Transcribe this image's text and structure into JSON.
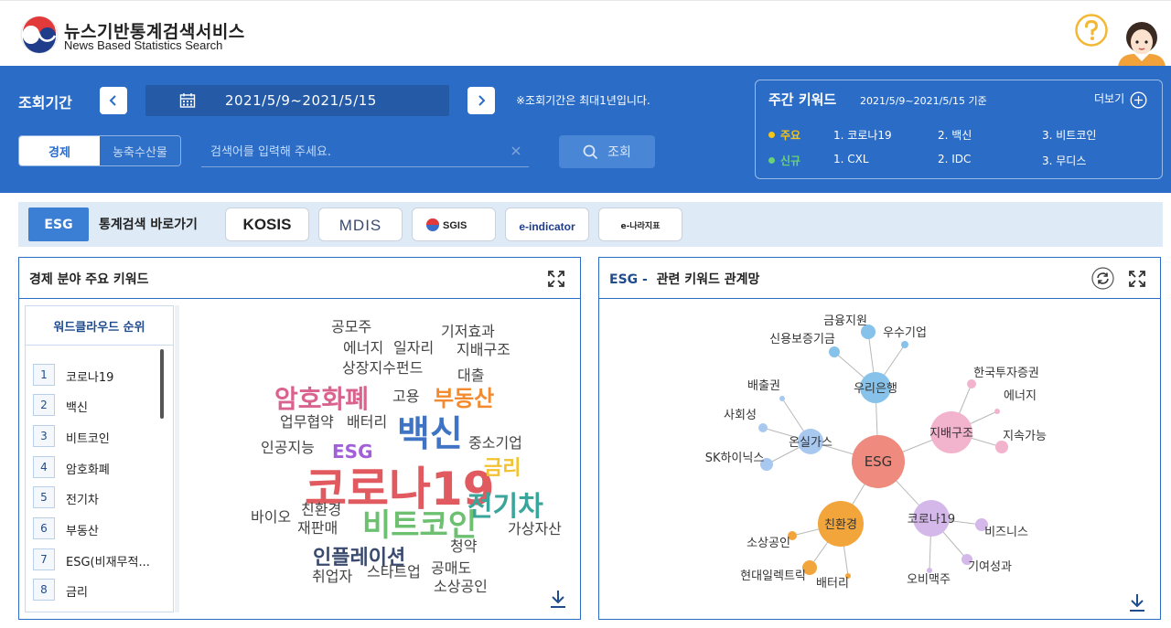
{
  "header": {
    "title": "뉴스기반통계검색서비스",
    "subtitle": "News Based Statistics Search"
  },
  "search": {
    "period_label": "조회기간",
    "date_range": "2021/5/9~2021/5/15",
    "period_note": "※조회기간은 최대1년입니다.",
    "tabs": [
      {
        "label": "경제",
        "active": true
      },
      {
        "label": "농축수산물",
        "active": false
      }
    ],
    "placeholder": "검색어를 입력해 주세요.",
    "button_label": "조회"
  },
  "weekly": {
    "title": "주간 키워드",
    "date_note": "2021/5/9~2021/5/15 기준",
    "more_label": "더보기",
    "main": {
      "tag": "주요",
      "items": [
        "1. 코로나19",
        "2. 백신",
        "3. 비트코인"
      ]
    },
    "new": {
      "tag": "신규",
      "items": [
        "1. CXL",
        "2. IDC",
        "3. 무디스"
      ]
    }
  },
  "shortcut": {
    "badge": "ESG",
    "label": "통계검색 바로가기",
    "sites": [
      "KOSIS",
      "MDIS",
      "SGIS",
      "e-indicator",
      "e-나라지표"
    ]
  },
  "wordcloud_panel": {
    "title": "경제 분야 주요 키워드",
    "rank_title": "워드클라우드 순위",
    "ranks": [
      {
        "num": "1",
        "label": "코로나19"
      },
      {
        "num": "2",
        "label": "백신"
      },
      {
        "num": "3",
        "label": "비트코인"
      },
      {
        "num": "4",
        "label": "암호화폐"
      },
      {
        "num": "5",
        "label": "전기차"
      },
      {
        "num": "6",
        "label": "부동산"
      },
      {
        "num": "7",
        "label": "ESG(비재무적..."
      },
      {
        "num": "8",
        "label": "금리"
      }
    ],
    "cloud": [
      {
        "text": "코로나19",
        "color": "#e05a5f"
      },
      {
        "text": "백신",
        "color": "#3f74c4"
      },
      {
        "text": "비트코인",
        "color": "#6cc070"
      },
      {
        "text": "암호화폐",
        "color": "#d9628f"
      },
      {
        "text": "전기차",
        "color": "#3aa59b"
      },
      {
        "text": "부동산",
        "color": "#f28b30"
      },
      {
        "text": "ESG",
        "color": "#a160d8"
      },
      {
        "text": "금리",
        "color": "#f2c230"
      },
      {
        "text": "인플레이션",
        "color": "#3a4a6e"
      },
      {
        "text": "공모주",
        "color": "#444444"
      },
      {
        "text": "에너지",
        "color": "#444444"
      },
      {
        "text": "일자리",
        "color": "#444444"
      },
      {
        "text": "기저효과",
        "color": "#444444"
      },
      {
        "text": "지배구조",
        "color": "#444444"
      },
      {
        "text": "상장지수펀드",
        "color": "#444444"
      },
      {
        "text": "대출",
        "color": "#444444"
      },
      {
        "text": "고용",
        "color": "#444444"
      },
      {
        "text": "업무협약",
        "color": "#444444"
      },
      {
        "text": "배터리",
        "color": "#444444"
      },
      {
        "text": "인공지능",
        "color": "#444444"
      },
      {
        "text": "중소기업",
        "color": "#444444"
      },
      {
        "text": "친환경",
        "color": "#444444"
      },
      {
        "text": "바이오",
        "color": "#444444"
      },
      {
        "text": "재판매",
        "color": "#444444"
      },
      {
        "text": "가상자산",
        "color": "#444444"
      },
      {
        "text": "청약",
        "color": "#444444"
      },
      {
        "text": "공매도",
        "color": "#444444"
      },
      {
        "text": "취업자",
        "color": "#444444"
      },
      {
        "text": "스타트업",
        "color": "#444444"
      },
      {
        "text": "소상공인",
        "color": "#444444"
      }
    ]
  },
  "network_panel": {
    "title_prefix": "ESG -",
    "title": "관련 키워드 관계망",
    "nodes": [
      {
        "label": "ESG",
        "color": "#ee8a7e"
      },
      {
        "label": "우리은행",
        "color": "#86c2ea"
      },
      {
        "label": "지배구조",
        "color": "#f2b3cc"
      },
      {
        "label": "온실가스",
        "color": "#a9c8f0"
      },
      {
        "label": "친환경",
        "color": "#f2a53a"
      },
      {
        "label": "코로나19",
        "color": "#d5b8ea"
      },
      {
        "label": "금융지원",
        "color": "#86c2ea"
      },
      {
        "label": "우수기업",
        "color": "#86c2ea"
      },
      {
        "label": "신용보증기금",
        "color": "#86c2ea"
      },
      {
        "label": "한국투자증권",
        "color": "#f2b3cc"
      },
      {
        "label": "에너지",
        "color": "#f2b3cc"
      },
      {
        "label": "지속가능",
        "color": "#f2b3cc"
      },
      {
        "label": "배출권",
        "color": "#a9c8f0"
      },
      {
        "label": "사회성",
        "color": "#a9c8f0"
      },
      {
        "label": "SK하이닉스",
        "color": "#a9c8f0"
      },
      {
        "label": "소상공인",
        "color": "#f2a53a"
      },
      {
        "label": "현대일렉트릭",
        "color": "#f2a53a"
      },
      {
        "label": "배터리",
        "color": "#f2a53a"
      },
      {
        "label": "비즈니스",
        "color": "#d5b8ea"
      },
      {
        "label": "기여성과",
        "color": "#d5b8ea"
      },
      {
        "label": "오비맥주",
        "color": "#d5b8ea"
      }
    ]
  }
}
